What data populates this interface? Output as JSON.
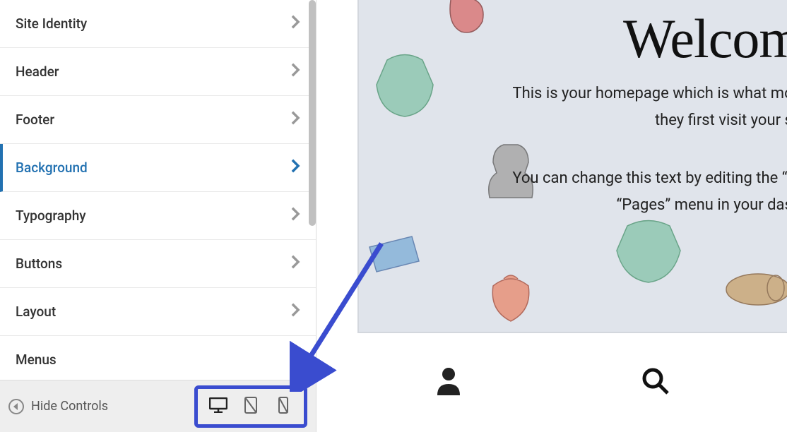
{
  "sidebar": {
    "items": [
      {
        "label": "Site Identity",
        "active": false
      },
      {
        "label": "Header",
        "active": false
      },
      {
        "label": "Footer",
        "active": false
      },
      {
        "label": "Background",
        "active": true
      },
      {
        "label": "Typography",
        "active": false
      },
      {
        "label": "Buttons",
        "active": false
      },
      {
        "label": "Layout",
        "active": false
      },
      {
        "label": "Menus",
        "active": false
      }
    ],
    "hide_controls_label": "Hide Controls"
  },
  "preview": {
    "heading": "Welcom",
    "line1": "This is your homepage which is what mos",
    "line2": "they first visit your sh",
    "line3": "You can change this text by editing the “W",
    "line4": "“Pages” menu in your dash"
  }
}
